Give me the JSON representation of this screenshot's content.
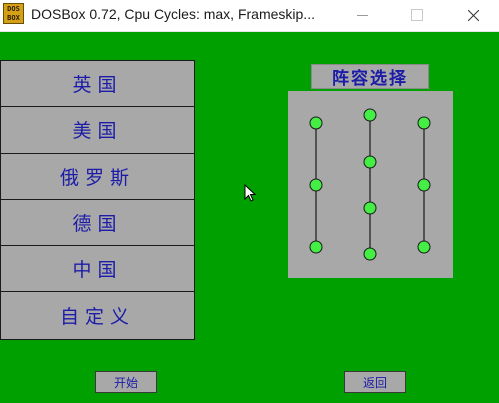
{
  "window": {
    "icon_text_line1": "DOS",
    "icon_text_line2": "BOX",
    "title": "DOSBox 0.72, Cpu Cycles:      max, Frameskip..."
  },
  "menu": {
    "items": [
      {
        "label": "英国"
      },
      {
        "label": "美国"
      },
      {
        "label": "俄罗斯"
      },
      {
        "label": "德国"
      },
      {
        "label": "中国"
      },
      {
        "label": "自定义"
      }
    ]
  },
  "formation": {
    "label": "阵容选择",
    "columns": 3,
    "node_color": "#44ee44"
  },
  "buttons": {
    "start": "开始",
    "back": "返回"
  },
  "colors": {
    "background": "#00a000",
    "panel": "#a8a8a8",
    "text": "#1c1ca8"
  }
}
